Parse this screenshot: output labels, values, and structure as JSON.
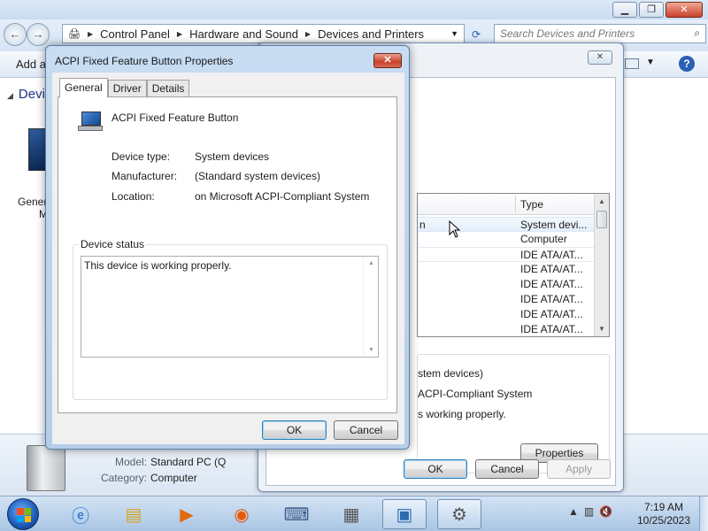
{
  "explorer": {
    "window_buttons": {
      "minimize": "▁",
      "maximize": "❐",
      "close": "✕"
    },
    "breadcrumb": [
      "Control Panel",
      "Hardware and Sound",
      "Devices and Printers"
    ],
    "search_placeholder": "Search Devices and Printers",
    "command_bar": {
      "add_label": "Add a"
    },
    "section_header": "Devi",
    "device_label_line1": "Gener",
    "device_label_line2": "M",
    "details": {
      "model_key": "Model:",
      "model_value": "Standard PC (Q",
      "category_key": "Category:",
      "category_value": "Computer"
    }
  },
  "device_manager_dialog": {
    "list_header_type": "Type",
    "list_rows": [
      {
        "name": "n",
        "type": "System devi...",
        "selected": true
      },
      {
        "name": "",
        "type": "Computer",
        "selected": false
      },
      {
        "name": "",
        "type": "IDE ATA/AT...",
        "selected": false
      },
      {
        "name": "",
        "type": "IDE ATA/AT...",
        "selected": false
      },
      {
        "name": "",
        "type": "IDE ATA/AT...",
        "selected": false
      },
      {
        "name": "",
        "type": "IDE ATA/AT...",
        "selected": false
      },
      {
        "name": "",
        "type": "IDE ATA/AT...",
        "selected": false
      },
      {
        "name": "",
        "type": "IDE ATA/AT...",
        "selected": false
      }
    ],
    "props_lines": [
      "stem devices)",
      " ACPI-Compliant System",
      "s working properly."
    ],
    "properties_button": "Properties",
    "ok_button": "OK",
    "cancel_button": "Cancel",
    "apply_button": "Apply"
  },
  "properties_dialog": {
    "title": "ACPI Fixed Feature Button Properties",
    "tabs": [
      {
        "label": "General",
        "active": true
      },
      {
        "label": "Driver",
        "active": false
      },
      {
        "label": "Details",
        "active": false
      }
    ],
    "device_name": "ACPI Fixed Feature Button",
    "fields": [
      {
        "key": "Device type:",
        "value": "System devices"
      },
      {
        "key": "Manufacturer:",
        "value": "(Standard system devices)"
      },
      {
        "key": "Location:",
        "value": "on Microsoft ACPI-Compliant System"
      }
    ],
    "status_legend": "Device status",
    "status_text": "This device is working properly.",
    "ok_button": "OK",
    "cancel_button": "Cancel"
  },
  "taskbar": {
    "time": "7:19 AM",
    "date": "10/25/2023"
  }
}
